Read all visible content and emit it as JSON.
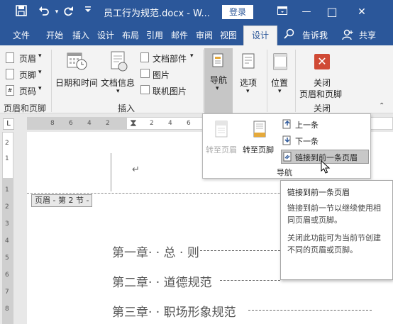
{
  "titlebar": {
    "title": "员工行为规范.docx - W...",
    "login": "登录",
    "save_icon": "save-icon",
    "undo_icon": "undo-icon",
    "redo_icon": "redo-icon",
    "customize_icon": "customize-quick-access-icon",
    "restore_icon": "ribbon-display-icon",
    "minimize": "—",
    "maximize": "□",
    "close": "✕"
  },
  "tabs": [
    {
      "label": "文件"
    },
    {
      "label": "开始"
    },
    {
      "label": "插入"
    },
    {
      "label": "设计"
    },
    {
      "label": "布局"
    },
    {
      "label": "引用"
    },
    {
      "label": "邮件"
    },
    {
      "label": "审阅"
    },
    {
      "label": "视图"
    },
    {
      "label": "设计"
    }
  ],
  "tell_me": "告诉我",
  "share": "共享",
  "ribbon": {
    "header": "页眉",
    "footer": "页脚",
    "page_number": "页码",
    "group_header_footer": "页眉和页脚",
    "date_time": "日期和时间",
    "doc_info": "文档信息",
    "doc_parts": "文档部件",
    "picture": "图片",
    "online_picture": "联机图片",
    "group_insert": "插入",
    "navigation": "导航",
    "options": "选项",
    "position": "位置",
    "close_line1": "关闭",
    "close_line2": "页眉和页脚",
    "group_close": "关闭"
  },
  "nav_dropdown": {
    "goto_header": "转至页眉",
    "goto_footer": "转至页脚",
    "previous": "上一条",
    "next": "下一条",
    "link_previous": "链接到前一条页眉",
    "group_label": "导航"
  },
  "tooltip": {
    "title": "链接到前一条页眉",
    "desc1": "链接到前一节以继续使用相同页眉或页脚。",
    "desc2": "关闭此功能可为当前节创建不同的页眉或页脚。"
  },
  "ruler": {
    "horizontal_ticks": [
      "8",
      "6",
      "4",
      "2",
      "2",
      "4",
      "6",
      "8",
      "10",
      "12",
      "14",
      "16"
    ],
    "vertical_ticks": [
      "2",
      "1",
      "1",
      "2",
      "3",
      "4",
      "5",
      "6",
      "7",
      "8",
      "9"
    ]
  },
  "document": {
    "header_tag": "页眉 - 第 2 节 -",
    "cursor_mark": "↵",
    "toc": [
      {
        "text": "第一章· · 总 · 则"
      },
      {
        "text": "第二章· · 道德规范"
      },
      {
        "text": "第三章· · 职场形象规范"
      }
    ]
  },
  "colors": {
    "accent": "#2b579a",
    "close_icon_red": "#d04a35"
  }
}
